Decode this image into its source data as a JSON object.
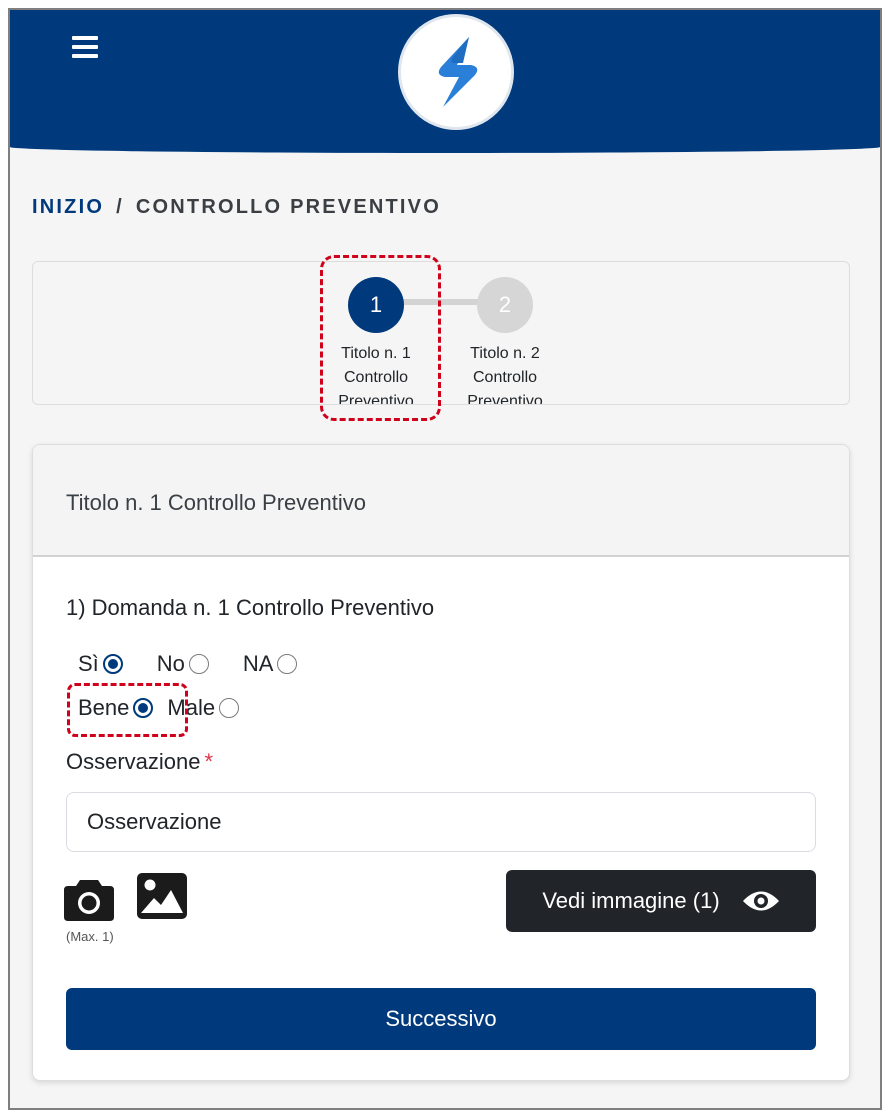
{
  "header": {
    "menu_icon": "hamburger-menu-icon",
    "logo_icon": "app-logo-icon",
    "colors": {
      "primary": "#003a7c",
      "logo_blue": "#2a7fd8"
    }
  },
  "breadcrumb": {
    "home": "INIZIO",
    "separator": "/",
    "current": "CONTROLLO PREVENTIVO"
  },
  "stepper": {
    "steps": [
      {
        "number": "1",
        "label_lines": [
          "Titolo n. 1",
          "Controllo",
          "Preventivo"
        ],
        "active": true
      },
      {
        "number": "2",
        "label_lines": [
          "Titolo n. 2",
          "Controllo",
          "Preventivo"
        ],
        "active": false
      }
    ]
  },
  "section": {
    "title": "Titolo n. 1 Controllo Preventivo",
    "question": "1) Domanda n. 1 Controllo Preventivo",
    "answer_options": [
      {
        "label": "Sì",
        "selected": true
      },
      {
        "label": "No",
        "selected": false
      },
      {
        "label": "NA",
        "selected": false
      }
    ],
    "rating_options": [
      {
        "label": "Bene",
        "selected": true
      },
      {
        "label": "Male",
        "selected": false
      }
    ],
    "observation": {
      "label": "Osservazione",
      "required_mark": "*",
      "placeholder": "Osservazione",
      "value": ""
    },
    "attachments": {
      "camera_icon": "camera-icon",
      "gallery_icon": "image-icon",
      "max_note": "(Max. 1)",
      "view_button_label": "Vedi immagine (1)",
      "view_icon": "eye-icon"
    },
    "next_button_label": "Successivo"
  }
}
